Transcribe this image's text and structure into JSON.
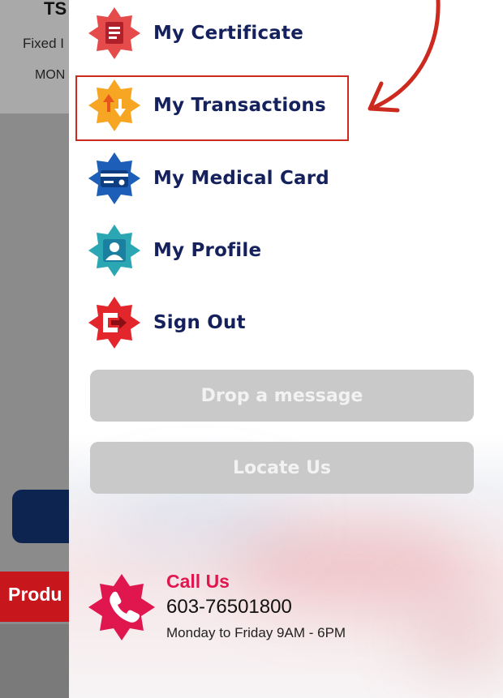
{
  "background_app": {
    "amount_partial": "TS",
    "fixed_partial": "Fixed I",
    "month_partial": "MON",
    "product_partial": "Produ"
  },
  "menu": {
    "items": [
      {
        "label": "My Certificate",
        "icon": "certificate-icon",
        "color": "#e64b4b"
      },
      {
        "label": "My Transactions",
        "icon": "transactions-icon",
        "color": "#f6a623",
        "highlighted": true
      },
      {
        "label": "My Medical Card",
        "icon": "medical-card-icon",
        "color": "#1d5fb8"
      },
      {
        "label": "My Profile",
        "icon": "profile-icon",
        "color": "#2aa7b3"
      },
      {
        "label": "Sign Out",
        "icon": "sign-out-icon",
        "color": "#e3262c"
      }
    ]
  },
  "buttons": {
    "drop_message": "Drop a message",
    "locate_us": "Locate Us"
  },
  "contact": {
    "title": "Call Us",
    "phone": "603-76501800",
    "hours": "Monday to Friday 9AM - 6PM",
    "icon": "phone-icon",
    "color": "#e0174f"
  },
  "colors": {
    "menu_text": "#14215c",
    "highlight": "#cc2a1e",
    "button_grey": "#c9c9c9"
  }
}
